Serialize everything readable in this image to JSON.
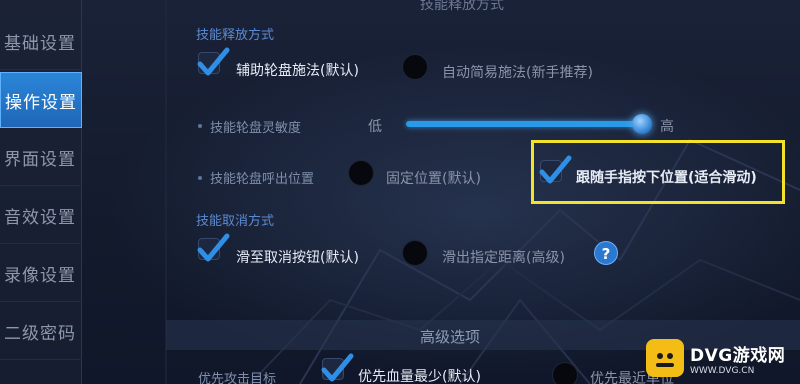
{
  "header": {
    "title": "技能释放方式"
  },
  "sidebar": {
    "items": [
      {
        "label": "基础设置"
      },
      {
        "label": "操作设置"
      },
      {
        "label": "界面设置"
      },
      {
        "label": "音效设置"
      },
      {
        "label": "录像设置"
      },
      {
        "label": "二级密码"
      }
    ],
    "active_index": 1
  },
  "skill_cast": {
    "title": "技能释放方式",
    "options": [
      {
        "label": "辅助轮盘施法(默认)",
        "selected": true
      },
      {
        "label": "自动简易施法(新手推荐)",
        "selected": false
      }
    ]
  },
  "wheel_sensitivity": {
    "label": "技能轮盘灵敏度",
    "low_label": "低",
    "high_label": "高",
    "value": 1.0
  },
  "wheel_position": {
    "label": "技能轮盘呼出位置",
    "options": [
      {
        "label": "固定位置(默认)",
        "selected": false
      },
      {
        "label": "跟随手指按下位置(适合滑动)",
        "selected": true
      }
    ]
  },
  "skill_cancel": {
    "title": "技能取消方式",
    "options": [
      {
        "label": "滑至取消按钮(默认)",
        "selected": true
      },
      {
        "label": "滑出指定距离(高级)",
        "selected": false
      }
    ],
    "help": "?"
  },
  "advanced": {
    "title": "高级选项",
    "target_label": "优先攻击目标",
    "options": [
      {
        "label": "优先血量最少(默认)",
        "selected": true
      },
      {
        "label": "优先最近单位",
        "selected": false
      }
    ]
  },
  "watermark": {
    "name": "DVG游戏网",
    "url": "WWW.DVG.CN"
  },
  "colors": {
    "accent": "#2b86d8",
    "highlight": "#f2e22b",
    "check": "#2f8fe6"
  }
}
